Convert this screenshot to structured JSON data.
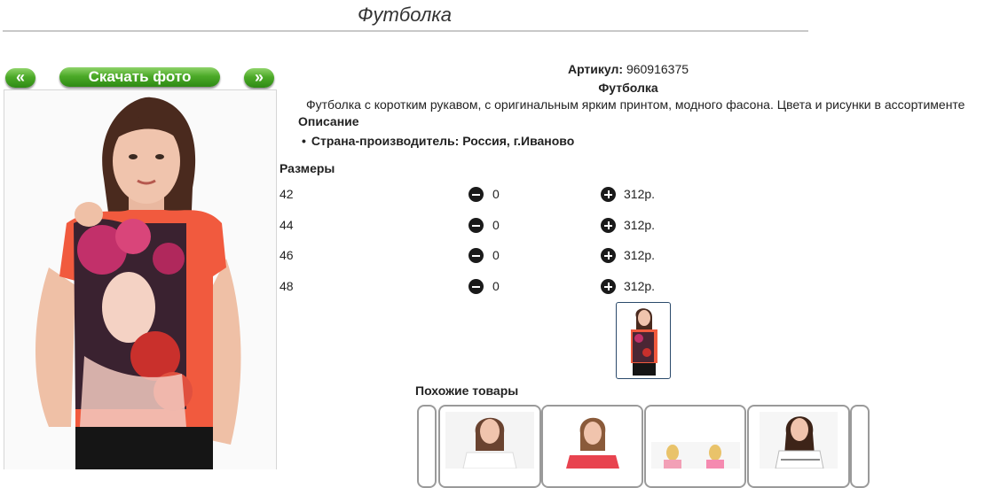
{
  "page_title": "Футболка",
  "gallery": {
    "prev_label": "«",
    "next_label": "»",
    "download_label": "Скачать фото"
  },
  "product": {
    "article_label": "Артикул:",
    "article_value": "960916375",
    "name": "Футболка",
    "description": "Футболка с коротким рукавом, с оригинальным ярким принтом, модного фасона. Цвета и рисунки в ассортименте",
    "description_heading": "Описание",
    "country": "Страна-производитель: Россия, г.Иваново"
  },
  "sizes": {
    "heading": "Размеры",
    "rows": [
      {
        "size": "42",
        "qty": "0",
        "price": "312р."
      },
      {
        "size": "44",
        "qty": "0",
        "price": "312р."
      },
      {
        "size": "46",
        "qty": "0",
        "price": "312р."
      },
      {
        "size": "48",
        "qty": "0",
        "price": "312р."
      }
    ]
  },
  "similar": {
    "heading": "Похожие товары"
  },
  "colors": {
    "button_green": "#4caa28",
    "rule": "#c8c8c8",
    "thumb_border": "#2b4a6b"
  }
}
